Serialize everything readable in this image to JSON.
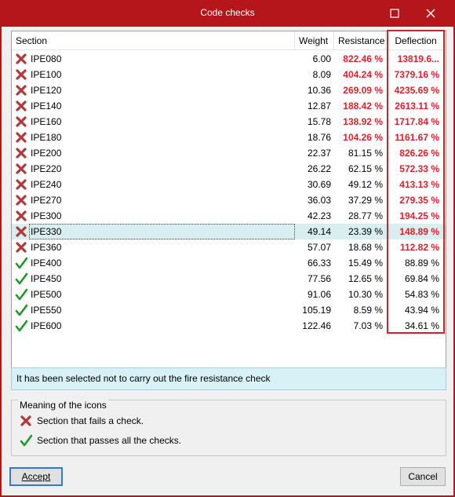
{
  "window": {
    "title": "Code checks"
  },
  "table": {
    "headers": {
      "section": "Section",
      "weight": "Weight",
      "resistance": "Resistance",
      "deflection": "Deflection"
    },
    "rows": [
      {
        "section": "IPE080",
        "weight": "6.00",
        "resistance": "822.46 %",
        "deflection": "13819.6...",
        "status": "fail",
        "res_fail": true,
        "def_fail": true
      },
      {
        "section": "IPE100",
        "weight": "8.09",
        "resistance": "404.24 %",
        "deflection": "7379.16 %",
        "status": "fail",
        "res_fail": true,
        "def_fail": true
      },
      {
        "section": "IPE120",
        "weight": "10.36",
        "resistance": "269.09 %",
        "deflection": "4235.69 %",
        "status": "fail",
        "res_fail": true,
        "def_fail": true
      },
      {
        "section": "IPE140",
        "weight": "12.87",
        "resistance": "188.42 %",
        "deflection": "2613.11 %",
        "status": "fail",
        "res_fail": true,
        "def_fail": true
      },
      {
        "section": "IPE160",
        "weight": "15.78",
        "resistance": "138.92 %",
        "deflection": "1717.84 %",
        "status": "fail",
        "res_fail": true,
        "def_fail": true
      },
      {
        "section": "IPE180",
        "weight": "18.76",
        "resistance": "104.26 %",
        "deflection": "1161.67 %",
        "status": "fail",
        "res_fail": true,
        "def_fail": true
      },
      {
        "section": "IPE200",
        "weight": "22.37",
        "resistance": "81.15 %",
        "deflection": "826.26 %",
        "status": "fail",
        "res_fail": false,
        "def_fail": true
      },
      {
        "section": "IPE220",
        "weight": "26.22",
        "resistance": "62.15 %",
        "deflection": "572.33 %",
        "status": "fail",
        "res_fail": false,
        "def_fail": true
      },
      {
        "section": "IPE240",
        "weight": "30.69",
        "resistance": "49.12 %",
        "deflection": "413.13 %",
        "status": "fail",
        "res_fail": false,
        "def_fail": true
      },
      {
        "section": "IPE270",
        "weight": "36.03",
        "resistance": "37.29 %",
        "deflection": "279.35 %",
        "status": "fail",
        "res_fail": false,
        "def_fail": true
      },
      {
        "section": "IPE300",
        "weight": "42.23",
        "resistance": "28.77 %",
        "deflection": "194.25 %",
        "status": "fail",
        "res_fail": false,
        "def_fail": true
      },
      {
        "section": "IPE330",
        "weight": "49.14",
        "resistance": "23.39 %",
        "deflection": "148.89 %",
        "status": "fail",
        "res_fail": false,
        "def_fail": true,
        "selected": true
      },
      {
        "section": "IPE360",
        "weight": "57.07",
        "resistance": "18.68 %",
        "deflection": "112.82 %",
        "status": "fail",
        "res_fail": false,
        "def_fail": true
      },
      {
        "section": "IPE400",
        "weight": "66.33",
        "resistance": "15.49 %",
        "deflection": "88.89 %",
        "status": "pass",
        "res_fail": false,
        "def_fail": false
      },
      {
        "section": "IPE450",
        "weight": "77.56",
        "resistance": "12.65 %",
        "deflection": "69.84 %",
        "status": "pass",
        "res_fail": false,
        "def_fail": false
      },
      {
        "section": "IPE500",
        "weight": "91.06",
        "resistance": "10.30 %",
        "deflection": "54.83 %",
        "status": "pass",
        "res_fail": false,
        "def_fail": false
      },
      {
        "section": "IPE550",
        "weight": "105.19",
        "resistance": "8.59 %",
        "deflection": "43.94 %",
        "status": "pass",
        "res_fail": false,
        "def_fail": false
      },
      {
        "section": "IPE600",
        "weight": "122.46",
        "resistance": "7.03 %",
        "deflection": "34.61 %",
        "status": "pass",
        "res_fail": false,
        "def_fail": false
      }
    ]
  },
  "info": {
    "text": "It has been selected not to carry out the fire resistance check"
  },
  "legend": {
    "title": "Meaning of the icons",
    "fail_label": "Section that fails a check.",
    "pass_label": "Section that passes all the checks."
  },
  "buttons": {
    "accept": "Accept",
    "cancel": "Cancel"
  },
  "colors": {
    "frame": "#b5161b",
    "fail_text": "#e0202a",
    "pass_icon": "#1f9a2a",
    "fail_icon": "#b03a3a",
    "selected_row": "#d9eef0"
  },
  "icons": {
    "fail": "red-x-icon",
    "pass": "green-check-icon",
    "maximize": "maximize-icon",
    "close": "close-icon"
  }
}
